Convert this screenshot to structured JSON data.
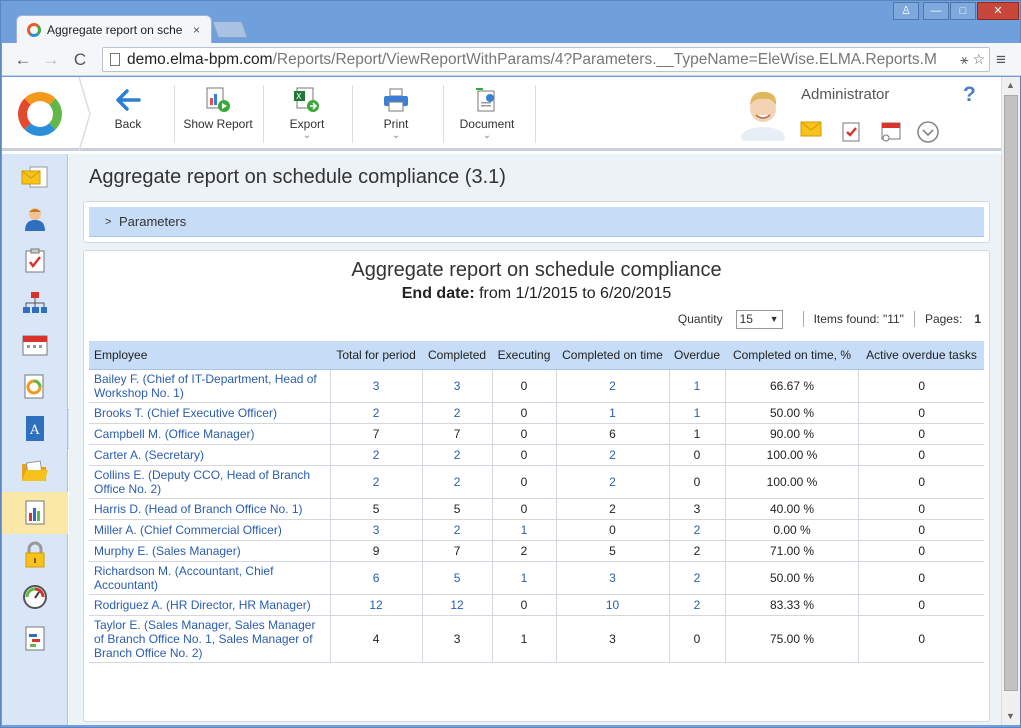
{
  "browser": {
    "tab_title": "Aggregate report on sche",
    "tab_close": "×",
    "url_host": "demo.elma-bpm.com",
    "url_path": "/Reports/Report/ViewReportWithParams/4?Parameters.__TypeName=EleWise.ELMA.Reports.M",
    "nav": {
      "back": "←",
      "forward": "→",
      "reload": "C",
      "menu": "≡"
    },
    "window": {
      "user": "♙",
      "minimize": "—",
      "maximize": "□",
      "close": "✕"
    }
  },
  "toolbar": {
    "back": "Back",
    "show_report": "Show Report",
    "export": "Export",
    "print": "Print",
    "document": "Document",
    "caret": "⌄"
  },
  "user": {
    "name": "Administrator",
    "help": "?"
  },
  "colors": {
    "accent": "#2a5db0",
    "header_bg": "#c7dcf6",
    "active_item": "#fbe7a6",
    "sidebar_bg": "#d8e6f7"
  },
  "page": {
    "title": "Aggregate report on schedule compliance (3.1)"
  },
  "parameters": {
    "label": "Parameters",
    "chevron": ">"
  },
  "report": {
    "title": "Aggregate report on schedule compliance",
    "end_date_label": "End date:",
    "end_date_value": "from 1/1/2015 to 6/20/2015",
    "quantity_label": "Quantity",
    "quantity_value": "15",
    "items_found": "Items found: \"11\"",
    "pages_label": "Pages:",
    "pages_value": "1",
    "columns": [
      "Employee",
      "Total for period",
      "Completed",
      "Executing",
      "Completed on time",
      "Overdue",
      "Completed on time, %",
      "Active overdue tasks"
    ],
    "rows": [
      [
        "Bailey F. (Chief of IT-Department, Head of Workshop No. 1)",
        "3",
        "3",
        "0",
        "2",
        "1",
        "66.67 %",
        "0"
      ],
      [
        "Brooks T. (Chief Executive Officer)",
        "2",
        "2",
        "0",
        "1",
        "1",
        "50.00 %",
        "0"
      ],
      [
        "Campbell M. (Office Manager)",
        "7",
        "7",
        "0",
        "6",
        "1",
        "90.00 %",
        "0"
      ],
      [
        "Carter A. (Secretary)",
        "2",
        "2",
        "0",
        "2",
        "0",
        "100.00 %",
        "0"
      ],
      [
        "Collins E. (Deputy CCO, Head of Branch Office No. 2)",
        "2",
        "2",
        "0",
        "2",
        "0",
        "100.00 %",
        "0"
      ],
      [
        "Harris D. (Head of Branch Office No. 1)",
        "5",
        "5",
        "0",
        "2",
        "3",
        "40.00 %",
        "0"
      ],
      [
        "Miller A. (Chief Commercial Officer)",
        "3",
        "2",
        "1",
        "0",
        "2",
        "0.00 %",
        "0"
      ],
      [
        "Murphy E. (Sales Manager)",
        "9",
        "7",
        "2",
        "5",
        "2",
        "71.00 %",
        "0"
      ],
      [
        "Richardson M. (Accountant, Chief Accountant)",
        "6",
        "5",
        "1",
        "3",
        "2",
        "50.00 %",
        "0"
      ],
      [
        "Rodriguez A. (HR Director, HR Manager)",
        "12",
        "12",
        "0",
        "10",
        "2",
        "83.33 %",
        "0"
      ],
      [
        "Taylor E. (Sales Manager, Sales Manager of Branch Office No. 1, Sales Manager of Branch Office No. 2)",
        "4",
        "3",
        "1",
        "3",
        "0",
        "75.00 %",
        "0"
      ]
    ],
    "links": [
      [
        true,
        true,
        true,
        false,
        true,
        true,
        false,
        false
      ],
      [
        true,
        true,
        true,
        false,
        true,
        true,
        false,
        false
      ],
      [
        true,
        false,
        false,
        false,
        false,
        false,
        false,
        false
      ],
      [
        true,
        true,
        true,
        false,
        true,
        false,
        false,
        false
      ],
      [
        true,
        true,
        true,
        false,
        true,
        false,
        false,
        false
      ],
      [
        true,
        false,
        false,
        false,
        false,
        false,
        false,
        false
      ],
      [
        true,
        true,
        true,
        true,
        false,
        true,
        false,
        false
      ],
      [
        true,
        false,
        false,
        false,
        false,
        false,
        false,
        false
      ],
      [
        true,
        true,
        true,
        true,
        true,
        true,
        false,
        false
      ],
      [
        true,
        true,
        true,
        false,
        true,
        true,
        false,
        false
      ],
      [
        true,
        false,
        false,
        false,
        false,
        false,
        false,
        false
      ]
    ]
  }
}
